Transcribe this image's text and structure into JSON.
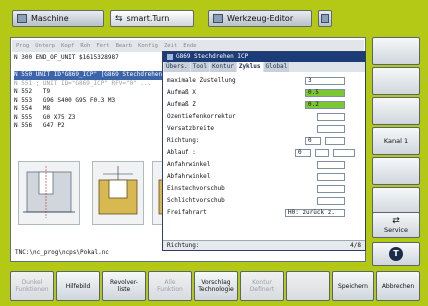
{
  "app_tabs": [
    {
      "label": "Maschine",
      "icon": "machine-icon"
    },
    {
      "label": "smart.Turn",
      "icon": "arrow-icon"
    },
    {
      "label": "Werkzeug-Editor",
      "icon": "tool-icon"
    }
  ],
  "section_tabs": [
    "Prog",
    "Unterp",
    "Kopf",
    "Roh",
    "Fert",
    "Bearb",
    "Konfig",
    "Zeit",
    "Ende"
  ],
  "code_lines": [
    "N 300 END_OF_UNIT $1615328987",
    "",
    "N 550 UNIT ID\"G869_ICP\" [G869 Stechdrehen",
    "N 551 ; UNIT ID=\"G869_ICP\" RFV=\"0\" ...",
    "N 552   T9",
    "N 553   G96 S400 G95 F0.3 M3",
    "N 554   M8",
    "N 555   G0 X75 Z3",
    "N 556   G47 P2"
  ],
  "dialog": {
    "title": "G869 Stechdrehen ICP",
    "tabs": [
      "Übers.",
      "Tool",
      "Kontur",
      "Zyklus",
      "Global"
    ],
    "fields": [
      {
        "label": "maximale Zustellung",
        "value": "3"
      },
      {
        "label": "Aufmaß X",
        "value": "0.5"
      },
      {
        "label": "Aufmaß Z",
        "value": "0.2"
      },
      {
        "label": "Ozentiefenkorrektur",
        "value": ""
      },
      {
        "label": "Versatzbreite",
        "value": ""
      },
      {
        "label": "Richtung:",
        "value": "0"
      },
      {
        "label": "Ablauf :",
        "value": "0"
      },
      {
        "label": "Anfahrwinkel",
        "value": ""
      },
      {
        "label": "Abfahrwinkel",
        "value": ""
      },
      {
        "label": "Einstechvorschub",
        "value": ""
      },
      {
        "label": "Schlichtvorschub",
        "value": ""
      },
      {
        "label": "Freifahrart",
        "value": "H0: zurück z."
      }
    ],
    "status_label": "Richtung:",
    "page": "4/8"
  },
  "path": "TNC:\\nc_prog\\ncps\\Pokal.nc",
  "vertical_softkeys": [
    "",
    "",
    "",
    "Kanal 1",
    "",
    "",
    "Service",
    ""
  ],
  "horizontal_softkeys": [
    {
      "label": "Dunkel\nFunktionen",
      "enabled": false
    },
    {
      "label": "Hilfebild",
      "enabled": true
    },
    {
      "label": "Revolver-\nliste",
      "enabled": true
    },
    {
      "label": "Alle\nFunktion",
      "enabled": false
    },
    {
      "label": "Vorschlag\nTechnologie",
      "enabled": true
    },
    {
      "label": "Kontur\nDefinert",
      "enabled": false
    },
    {
      "label": "",
      "enabled": false
    },
    {
      "label": "Speichern",
      "enabled": true
    },
    {
      "label": "Abbrechen",
      "enabled": true
    }
  ]
}
